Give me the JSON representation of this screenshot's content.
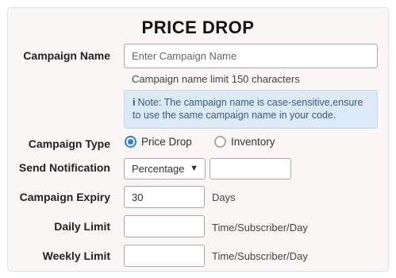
{
  "title": "PRICE DROP",
  "campaign_name": {
    "label": "Campaign Name",
    "placeholder": "Enter Campaign Name",
    "hint": "Campaign name limit 150 characters",
    "note_icon": "i",
    "note": "Note: The campaign name is case-sensitive,ensure to use the same campaign name in your code."
  },
  "campaign_type": {
    "label": "Campaign Type",
    "options": [
      {
        "label": "Price Drop",
        "selected": true
      },
      {
        "label": "Inventory",
        "selected": false
      }
    ]
  },
  "send_notification": {
    "label": "Send Notification",
    "select_value": "Percentage",
    "caret": "▼",
    "value": ""
  },
  "campaign_expiry": {
    "label": "Campaign Expiry",
    "value": "30",
    "unit": "Days"
  },
  "daily_limit": {
    "label": "Daily Limit",
    "value": "",
    "unit": "Time/Subscriber/Day"
  },
  "weekly_limit": {
    "label": "Weekly Limit",
    "value": "",
    "unit": "Time/Subscriber/Day"
  },
  "colors": {
    "accent": "#2f7ddb",
    "note_bg": "#dceaf8",
    "panel_bg": "#fbf6f6"
  }
}
